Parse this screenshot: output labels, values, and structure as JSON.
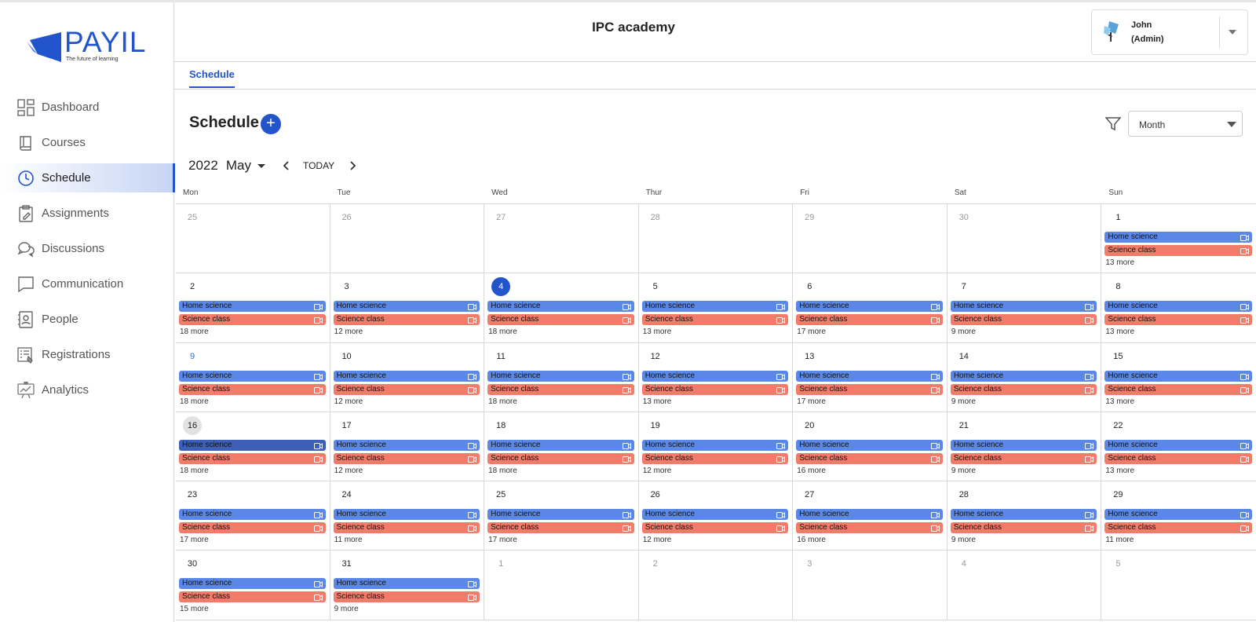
{
  "brand": {
    "name": "PAYIL",
    "tagline": "The future of learning"
  },
  "sidebar": {
    "items": [
      {
        "label": "Dashboard",
        "icon": "dashboard-icon"
      },
      {
        "label": "Courses",
        "icon": "book-icon"
      },
      {
        "label": "Schedule",
        "icon": "clock-icon",
        "active": true
      },
      {
        "label": "Assignments",
        "icon": "clipboard-icon"
      },
      {
        "label": "Discussions",
        "icon": "chat-bubbles-icon"
      },
      {
        "label": "Communication",
        "icon": "message-icon"
      },
      {
        "label": "People",
        "icon": "person-card-icon"
      },
      {
        "label": "Registrations",
        "icon": "form-icon"
      },
      {
        "label": "Analytics",
        "icon": "analytics-icon"
      }
    ]
  },
  "header": {
    "title": "IPC academy"
  },
  "user": {
    "name": "John",
    "role": "(Admin)"
  },
  "tabs": [
    {
      "label": "Schedule",
      "active": true
    }
  ],
  "schedule": {
    "title": "Schedule",
    "view": "Month"
  },
  "calendar_nav": {
    "year": "2022",
    "month": "May",
    "today_label": "TODAY"
  },
  "weekdays": [
    "Mon",
    "Tue",
    "Wed",
    "Thur",
    "Fri",
    "Sat",
    "Sun"
  ],
  "event_names": {
    "home": "Home science",
    "science": "Science class"
  },
  "colors": {
    "accent": "#2255cc",
    "home_event": "#5b88e6",
    "science_event": "#f07c69"
  },
  "weeks": [
    [
      {
        "d": "25",
        "muted": true
      },
      {
        "d": "26",
        "muted": true
      },
      {
        "d": "27",
        "muted": true
      },
      {
        "d": "28",
        "muted": true
      },
      {
        "d": "29",
        "muted": true
      },
      {
        "d": "30",
        "muted": true
      },
      {
        "d": "1",
        "events": true,
        "more": "13 more"
      }
    ],
    [
      {
        "d": "2",
        "events": true,
        "more": "18 more"
      },
      {
        "d": "3",
        "events": true,
        "more": "12 more"
      },
      {
        "d": "4",
        "today": true,
        "events": true,
        "more": "18 more"
      },
      {
        "d": "5",
        "events": true,
        "more": "13 more"
      },
      {
        "d": "6",
        "events": true,
        "more": "17 more"
      },
      {
        "d": "7",
        "events": true,
        "more": "9 more"
      },
      {
        "d": "8",
        "events": true,
        "more": "13 more"
      }
    ],
    [
      {
        "d": "9",
        "blue": true,
        "events": true,
        "more": "18 more"
      },
      {
        "d": "10",
        "events": true,
        "more": "12 more"
      },
      {
        "d": "11",
        "events": true,
        "more": "18 more"
      },
      {
        "d": "12",
        "events": true,
        "more": "13 more"
      },
      {
        "d": "13",
        "events": true,
        "more": "17 more"
      },
      {
        "d": "14",
        "events": true,
        "more": "9 more"
      },
      {
        "d": "15",
        "events": true,
        "more": "13 more"
      }
    ],
    [
      {
        "d": "16",
        "selected": true,
        "events": true,
        "more": "18 more"
      },
      {
        "d": "17",
        "events": true,
        "more": "12 more"
      },
      {
        "d": "18",
        "events": true,
        "more": "18 more"
      },
      {
        "d": "19",
        "events": true,
        "more": "12 more"
      },
      {
        "d": "20",
        "events": true,
        "more": "16 more"
      },
      {
        "d": "21",
        "events": true,
        "more": "9 more"
      },
      {
        "d": "22",
        "events": true,
        "more": "13 more"
      }
    ],
    [
      {
        "d": "23",
        "events": true,
        "more": "17 more"
      },
      {
        "d": "24",
        "events": true,
        "more": "11 more"
      },
      {
        "d": "25",
        "events": true,
        "more": "17 more"
      },
      {
        "d": "26",
        "events": true,
        "more": "12 more"
      },
      {
        "d": "27",
        "events": true,
        "more": "16 more"
      },
      {
        "d": "28",
        "events": true,
        "more": "9 more"
      },
      {
        "d": "29",
        "events": true,
        "more": "11 more"
      }
    ],
    [
      {
        "d": "30",
        "events": true,
        "more": "15 more"
      },
      {
        "d": "31",
        "events": true,
        "more": "9 more"
      },
      {
        "d": "1",
        "muted": true
      },
      {
        "d": "2",
        "muted": true
      },
      {
        "d": "3",
        "muted": true
      },
      {
        "d": "4",
        "muted": true
      },
      {
        "d": "5",
        "muted": true
      }
    ]
  ]
}
